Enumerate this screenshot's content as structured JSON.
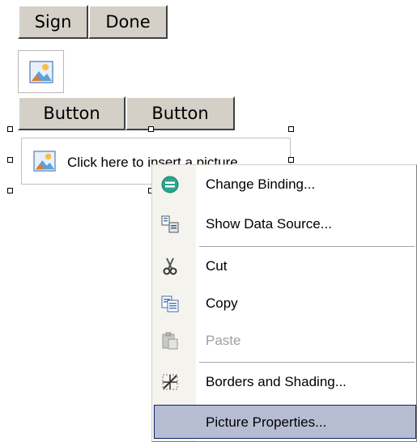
{
  "top_buttons": {
    "sign": "Sign",
    "done": "Done"
  },
  "mid_buttons": {
    "b1": "Button",
    "b2": "Button"
  },
  "picture_control": {
    "label": "Click here to insert a picture"
  },
  "context_menu": {
    "items": [
      {
        "label": "Change Binding...",
        "icon": "change-binding-icon"
      },
      {
        "label": "Show Data Source...",
        "icon": "data-source-icon"
      },
      {
        "label": "Cut",
        "icon": "scissors-icon"
      },
      {
        "label": "Copy",
        "icon": "copy-icon"
      },
      {
        "label": "Paste",
        "icon": "paste-icon",
        "disabled": true
      },
      {
        "label": "Borders and Shading...",
        "icon": "borders-icon"
      },
      {
        "label": "Picture Properties...",
        "highlighted": true
      }
    ]
  },
  "colors": {
    "menu_highlight": "#b6bdd2",
    "button_face": "#d4d0c8",
    "binding_icon": "#2ca58d"
  }
}
